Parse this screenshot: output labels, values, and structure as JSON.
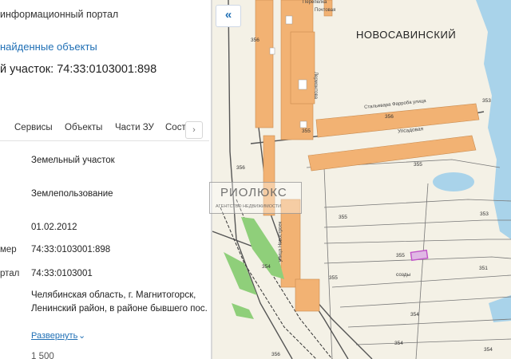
{
  "panel": {
    "portal_title": "информационный портал",
    "found_link": "найденные объекты",
    "parcel_title": "й участок: 74:33:0103001:898",
    "tabs": [
      {
        "label": "Сервисы"
      },
      {
        "label": "Объекты"
      },
      {
        "label": "Части ЗУ"
      },
      {
        "label": "Соста"
      }
    ],
    "tab_next_icon": "chevron-right",
    "rows": [
      {
        "label": "",
        "value": "Земельный участок"
      },
      {
        "label": "",
        "value": "Землепользование"
      },
      {
        "label": "",
        "value": "01.02.2012"
      },
      {
        "label": "мер",
        "value": "74:33:0103001:898"
      },
      {
        "label": "ртал",
        "value": "74:33:0103001"
      }
    ],
    "address": "Челябинская область, г. Магнитогорск, Ленинский район, в районе бывшего пос.",
    "expand_label": "Развернуть",
    "expand_icon": "chevron-down",
    "cut_value": "1 500"
  },
  "map": {
    "collapse_icon": "double-chevron-left",
    "district_label": "НОВОСАВИНСКИЙ",
    "street_labels": [
      "Перепелка",
      "Почтовая",
      "Стальевара Фарроба улица",
      "Упсадовая",
      "Лермонтова",
      "улица Новостроек"
    ],
    "numbers": [
      "356",
      "353",
      "356",
      "355",
      "355",
      "356",
      "355",
      "353",
      "355",
      "354",
      "355",
      "351",
      "354",
      "354",
      "354",
      "356"
    ],
    "settlement_small": "созды",
    "watermark_main": "РИОЛЮКС",
    "watermark_sub": "АГЕНТСТВО НЕДВИЖИМОСТИ",
    "colors": {
      "building": "#f2b273",
      "green": "#8fcf7a",
      "water": "#a9d3ea",
      "highlight": "#c054c8"
    }
  }
}
